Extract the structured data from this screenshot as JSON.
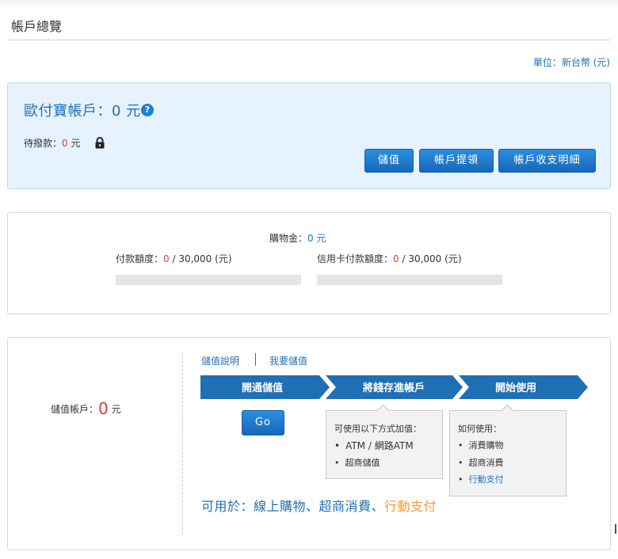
{
  "page": {
    "title": "帳戶總覽",
    "unit": "單位：新台幣 (元)"
  },
  "opay": {
    "title": "歐付寶帳戶：0 元",
    "help_icon": "question-circle-icon",
    "pending_label": "待撥款：",
    "pending_value": "0",
    "pending_unit": " 元",
    "lock_icon": "lock-icon",
    "buttons": {
      "deposit": "儲值",
      "withdraw": "帳戶提領",
      "detail": "帳戶收支明細"
    }
  },
  "shopping": {
    "label": "購物金：",
    "value": "0 元",
    "limit_label": "付款額度：",
    "limit_used": "0",
    "limit_rest": " / 30,000 (元)",
    "limit_used_fraction": 0,
    "cc_limit_label": "信用卡付款額度：",
    "cc_limit_used": "0",
    "cc_limit_rest": " / 30,000 (元)",
    "cc_limit_used_fraction": 0
  },
  "stored": {
    "label": "儲值帳戶：",
    "value": "0",
    "unit": " 元",
    "links": {
      "explain": "儲值說明",
      "want": "我要儲值"
    },
    "steps": [
      "開通儲值",
      "將錢存進帳戶",
      "開始使用"
    ],
    "step_color": "#1f6fb5",
    "go_button": "Go",
    "tip1": {
      "head": "可使用以下方式加值：",
      "items": [
        "ATM / 網路ATM",
        "超商儲值"
      ]
    },
    "tip2": {
      "head": "如何使用：",
      "items": [
        "消費購物",
        "超商消費",
        "行動支付"
      ]
    },
    "usable_prefix": "可用於：線上購物、超商消費、",
    "usable_highlight": "行動支付"
  },
  "colors": {
    "accent": "#1f6fb5",
    "button": "#1a72c0",
    "red": "#e03a3a",
    "orange": "#f39c34",
    "card_highlight_bg": "#e6f2fd"
  }
}
